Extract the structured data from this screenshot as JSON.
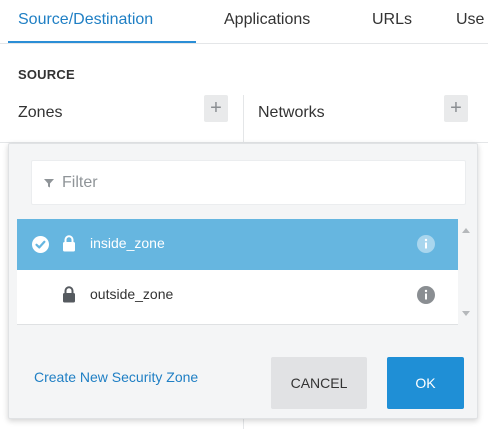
{
  "tabs": [
    {
      "label": "Source/Destination",
      "active": true
    },
    {
      "label": "Applications",
      "active": false
    },
    {
      "label": "URLs",
      "active": false
    },
    {
      "label": "Use",
      "active": false
    }
  ],
  "section": {
    "title": "SOURCE",
    "zones_label": "Zones",
    "networks_label": "Networks",
    "add_symbol": "+"
  },
  "popover": {
    "filter_placeholder": "Filter",
    "items": [
      {
        "label": "inside_zone",
        "selected": true,
        "icon": "lock-icon"
      },
      {
        "label": "outside_zone",
        "selected": false,
        "icon": "lock-icon"
      }
    ],
    "create_link": "Create New Security Zone",
    "cancel_label": "CANCEL",
    "ok_label": "OK"
  },
  "colors": {
    "accent": "#1f7fc4",
    "selected_row": "#66b6e0",
    "ok_button": "#1f8fd6",
    "cancel_button": "#e1e2e4",
    "popover_bg": "#f4f5f6"
  }
}
